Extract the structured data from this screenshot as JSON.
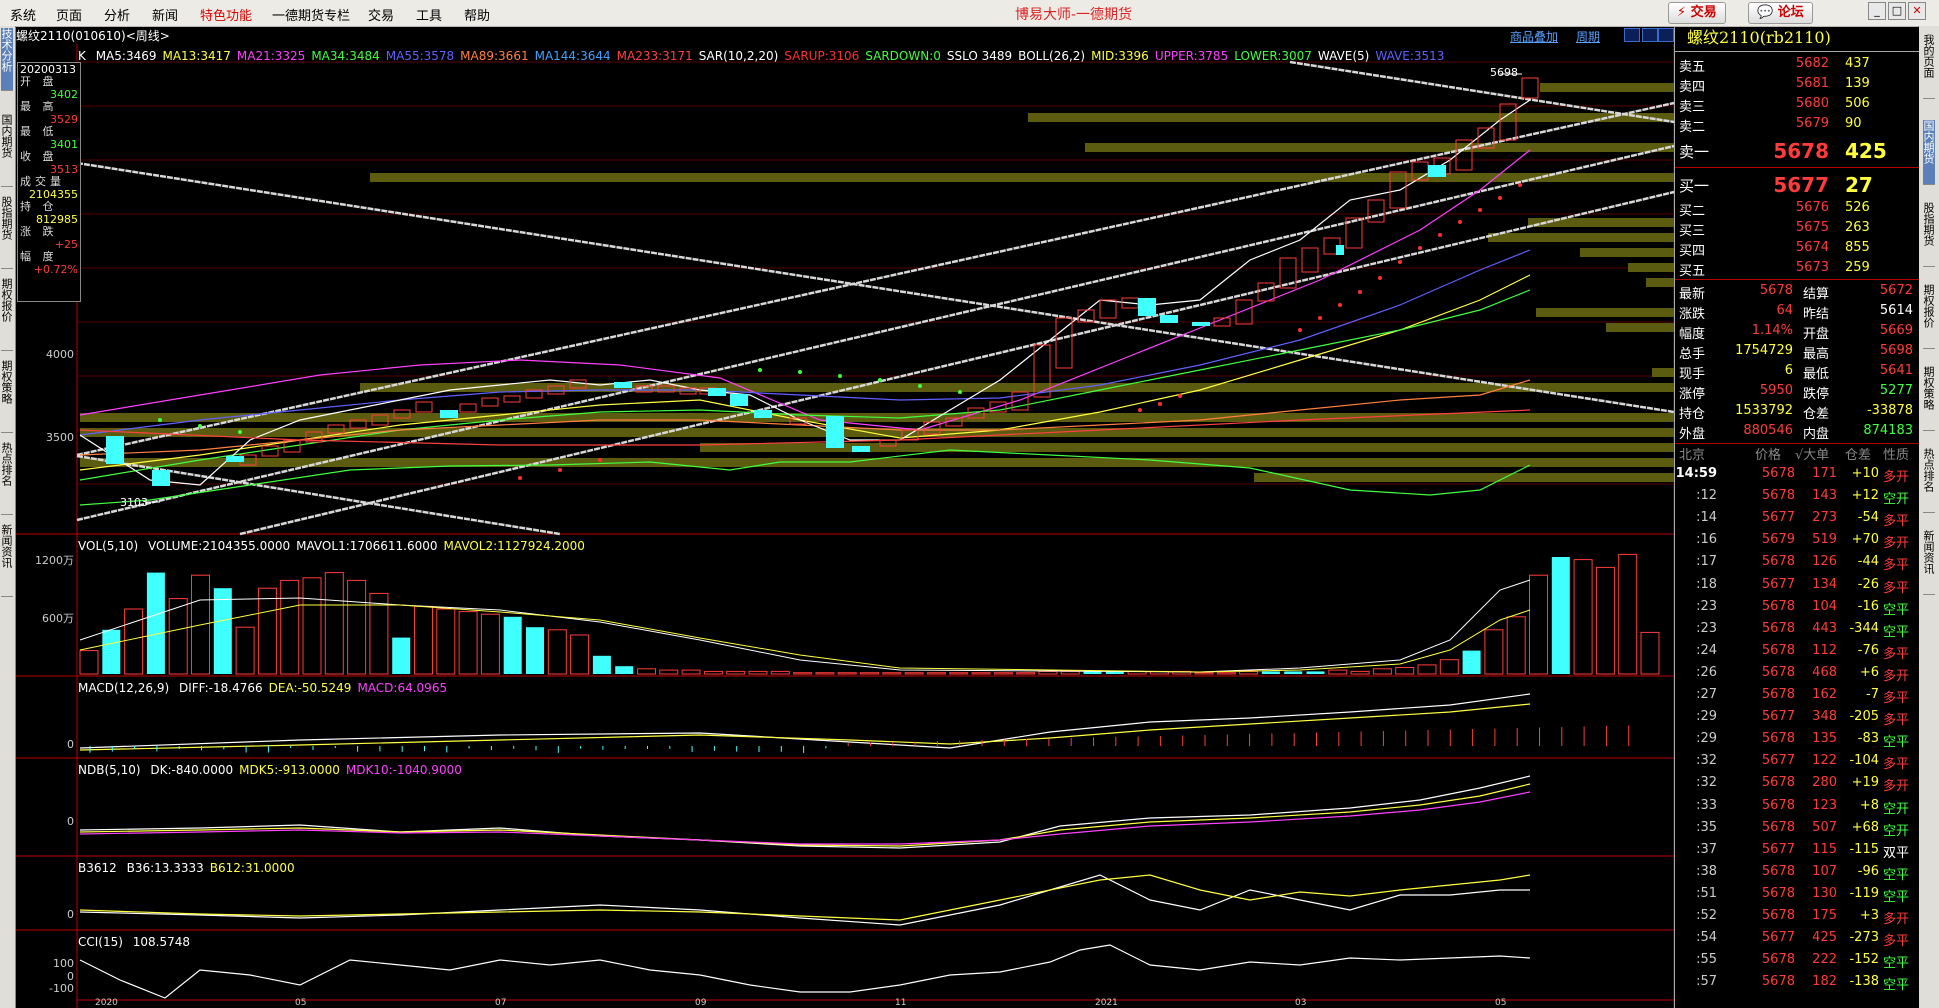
{
  "app": {
    "title": "博易大师-一德期货"
  },
  "menu": [
    "系统",
    "页面",
    "分析",
    "新闻",
    "特色功能",
    "一德期货专栏",
    "交易",
    "工具",
    "帮助"
  ],
  "top_buttons": {
    "trade": "交易",
    "forum": "论坛"
  },
  "left_tabs": [
    "技术分析",
    "国内期货",
    "股指期货",
    "期权报价",
    "期权策略",
    "热点排名",
    "新闻资讯"
  ],
  "right_tabs": [
    "我的页面",
    "国内期货",
    "股指期货",
    "期权报价",
    "期权策略",
    "热点排名",
    "新闻资讯"
  ],
  "chart": {
    "title": "螺纹2110(010610)<周线>",
    "toolbar": {
      "overlay": "商品叠加",
      "period": "周期"
    },
    "ma_prefix": "K",
    "ma_items": [
      {
        "text": "MA5:3469",
        "color": "#ffffff"
      },
      {
        "text": "MA13:3417",
        "color": "#ffff40"
      },
      {
        "text": "MA21:3325",
        "color": "#ff40ff"
      },
      {
        "text": "MA34:3484",
        "color": "#40ff40"
      },
      {
        "text": "MA55:3578",
        "color": "#6060ff"
      },
      {
        "text": "MA89:3661",
        "color": "#ff8040"
      },
      {
        "text": "MA144:3644",
        "color": "#40a0ff"
      },
      {
        "text": "MA233:3171",
        "color": "#ff4040"
      },
      {
        "text": "SAR(10,2,20)",
        "color": "#ffffff"
      },
      {
        "text": "SARUP:3106",
        "color": "#ff3030"
      },
      {
        "text": "SARDOWN:0",
        "color": "#40ff40"
      },
      {
        "text": "SSLO 3489",
        "color": "#ffffff"
      },
      {
        "text": "BOLL(26,2)",
        "color": "#ffffff"
      },
      {
        "text": "MID:3396",
        "color": "#ffff40"
      },
      {
        "text": "UPPER:3785",
        "color": "#ff40ff"
      },
      {
        "text": "LOWER:3007",
        "color": "#40ff40"
      },
      {
        "text": "WAVE(5)",
        "color": "#ffffff"
      },
      {
        "text": "WAVE:3513",
        "color": "#6060ff"
      }
    ],
    "price_axis": [
      "4000",
      "3500"
    ],
    "high_mark": "5698",
    "low_mark": "3103",
    "infobox": {
      "date": "20200313",
      "items": [
        {
          "k": "开 盘",
          "v": "3402",
          "c": "#40ff40"
        },
        {
          "k": "最 高",
          "v": "3529",
          "c": "#ff3b3b"
        },
        {
          "k": "最 低",
          "v": "3401",
          "c": "#40ff40"
        },
        {
          "k": "收 盘",
          "v": "3513",
          "c": "#ff3b3b"
        },
        {
          "k": "成交量",
          "v": "2104355",
          "c": "#ffff40"
        },
        {
          "k": "持 仓",
          "v": "812985",
          "c": "#ffff40"
        },
        {
          "k": "涨 跌",
          "v": "+25",
          "c": "#ff3b3b"
        },
        {
          "k": "幅 度",
          "v": "+0.72%",
          "c": "#ff3b3b"
        }
      ]
    },
    "vol": {
      "label": "VOL(5,10)",
      "items": [
        {
          "text": "VOLUME:2104355.0000",
          "color": "#ffffff"
        },
        {
          "text": "MAVOL1:1706611.6000",
          "color": "#ffffff"
        },
        {
          "text": "MAVOL2:1127924.2000",
          "color": "#ffff40"
        }
      ],
      "axis": [
        "1200万",
        "600万"
      ]
    },
    "macd": {
      "label": "MACD(12,26,9)",
      "items": [
        {
          "text": "DIFF:-18.4766",
          "color": "#ffffff"
        },
        {
          "text": "DEA:-50.5249",
          "color": "#ffff40"
        },
        {
          "text": "MACD:64.0965",
          "color": "#ff40ff"
        }
      ],
      "axis": [
        "0"
      ]
    },
    "ndb": {
      "label": "NDB(5,10)",
      "items": [
        {
          "text": "DK:-840.0000",
          "color": "#ffffff"
        },
        {
          "text": "MDK5:-913.0000",
          "color": "#ffff40"
        },
        {
          "text": "MDK10:-1040.9000",
          "color": "#ff40ff"
        }
      ],
      "axis": [
        "0"
      ]
    },
    "b3612": {
      "label": "B3612",
      "items": [
        {
          "text": "B36:13.3333",
          "color": "#ffffff"
        },
        {
          "text": "B612:31.0000",
          "color": "#ffff40"
        }
      ],
      "axis": [
        "0"
      ]
    },
    "cci": {
      "label": "CCI(15)",
      "items": [
        {
          "text": "108.5748",
          "color": "#ffffff"
        }
      ],
      "axis": [
        "100",
        "0",
        "-100"
      ]
    },
    "date_axis": [
      "2020",
      "05",
      "07",
      "09",
      "11",
      "2021",
      "03",
      "05"
    ]
  },
  "quote": {
    "title": "螺纹2110(rb2110)",
    "asks": [
      {
        "label": "卖五",
        "price": "5682",
        "vol": "437"
      },
      {
        "label": "卖四",
        "price": "5681",
        "vol": "139"
      },
      {
        "label": "卖三",
        "price": "5680",
        "vol": "506"
      },
      {
        "label": "卖二",
        "price": "5679",
        "vol": "90"
      },
      {
        "label": "卖一",
        "price": "5678",
        "vol": "425"
      }
    ],
    "bids": [
      {
        "label": "买一",
        "price": "5677",
        "vol": "27"
      },
      {
        "label": "买二",
        "price": "5676",
        "vol": "526"
      },
      {
        "label": "买三",
        "price": "5675",
        "vol": "263"
      },
      {
        "label": "买四",
        "price": "5674",
        "vol": "855"
      },
      {
        "label": "买五",
        "price": "5673",
        "vol": "259"
      }
    ],
    "stats": [
      {
        "k1": "最新",
        "v1": "5678",
        "c1": "#ff3b3b",
        "k2": "结算",
        "v2": "5672",
        "c2": "#ff3b3b"
      },
      {
        "k1": "涨跌",
        "v1": "64",
        "c1": "#ff3b3b",
        "k2": "昨结",
        "v2": "5614",
        "c2": "#ffffff"
      },
      {
        "k1": "幅度",
        "v1": "1.14%",
        "c1": "#ff3b3b",
        "k2": "开盘",
        "v2": "5669",
        "c2": "#ff3b3b"
      },
      {
        "k1": "总手",
        "v1": "1754729",
        "c1": "#ffff40",
        "k2": "最高",
        "v2": "5698",
        "c2": "#ff3b3b"
      },
      {
        "k1": "现手",
        "v1": "6",
        "c1": "#ffff40",
        "k2": "最低",
        "v2": "5641",
        "c2": "#ff3b3b"
      },
      {
        "k1": "涨停",
        "v1": "5950",
        "c1": "#ff3b3b",
        "k2": "跌停",
        "v2": "5277",
        "c2": "#40ff40"
      },
      {
        "k1": "持仓",
        "v1": "1533792",
        "c1": "#ffff40",
        "k2": "仓差",
        "v2": "-33878",
        "c2": "#ffff40"
      },
      {
        "k1": "外盘",
        "v1": "880546",
        "c1": "#ff3b3b",
        "k2": "内盘",
        "v2": "874183",
        "c2": "#40ff40"
      }
    ],
    "tick_header": {
      "loc": "北京",
      "price": "价格",
      "vol": "√大单",
      "diff": "仓差",
      "nature": "性质"
    },
    "ticks": [
      {
        "t": "14:59",
        "p": "5678",
        "v": "171",
        "d": "+10",
        "n": "多开",
        "nc": "#ff3b3b"
      },
      {
        "t": ":12",
        "p": "5678",
        "v": "143",
        "d": "+12",
        "n": "空开",
        "nc": "#40ff40"
      },
      {
        "t": ":14",
        "p": "5677",
        "v": "273",
        "d": "-54",
        "n": "多平",
        "nc": "#ff3b3b"
      },
      {
        "t": ":16",
        "p": "5679",
        "v": "519",
        "d": "+70",
        "n": "多开",
        "nc": "#ff3b3b"
      },
      {
        "t": ":17",
        "p": "5678",
        "v": "126",
        "d": "-44",
        "n": "多平",
        "nc": "#ff3b3b"
      },
      {
        "t": ":18",
        "p": "5677",
        "v": "134",
        "d": "-26",
        "n": "多平",
        "nc": "#ff3b3b"
      },
      {
        "t": ":23",
        "p": "5678",
        "v": "104",
        "d": "-16",
        "n": "空平",
        "nc": "#40ff40"
      },
      {
        "t": ":23",
        "p": "5678",
        "v": "443",
        "d": "-344",
        "n": "空平",
        "nc": "#40ff40"
      },
      {
        "t": ":24",
        "p": "5678",
        "v": "112",
        "d": "-76",
        "n": "多平",
        "nc": "#ff3b3b"
      },
      {
        "t": ":26",
        "p": "5678",
        "v": "468",
        "d": "+6",
        "n": "多开",
        "nc": "#ff3b3b"
      },
      {
        "t": ":27",
        "p": "5678",
        "v": "162",
        "d": "-7",
        "n": "多平",
        "nc": "#ff3b3b"
      },
      {
        "t": ":29",
        "p": "5677",
        "v": "348",
        "d": "-205",
        "n": "多平",
        "nc": "#ff3b3b"
      },
      {
        "t": ":29",
        "p": "5678",
        "v": "135",
        "d": "-83",
        "n": "空平",
        "nc": "#40ff40"
      },
      {
        "t": ":32",
        "p": "5677",
        "v": "122",
        "d": "-104",
        "n": "多平",
        "nc": "#ff3b3b"
      },
      {
        "t": ":32",
        "p": "5678",
        "v": "280",
        "d": "+19",
        "n": "多开",
        "nc": "#ff3b3b"
      },
      {
        "t": ":33",
        "p": "5678",
        "v": "123",
        "d": "+8",
        "n": "空开",
        "nc": "#40ff40"
      },
      {
        "t": ":35",
        "p": "5678",
        "v": "507",
        "d": "+68",
        "n": "空开",
        "nc": "#40ff40"
      },
      {
        "t": ":37",
        "p": "5677",
        "v": "115",
        "d": "-115",
        "n": "双平",
        "nc": "#ffffff"
      },
      {
        "t": ":38",
        "p": "5678",
        "v": "107",
        "d": "-96",
        "n": "空平",
        "nc": "#40ff40"
      },
      {
        "t": ":51",
        "p": "5678",
        "v": "130",
        "d": "-119",
        "n": "空平",
        "nc": "#40ff40"
      },
      {
        "t": ":52",
        "p": "5678",
        "v": "175",
        "d": "+3",
        "n": "多开",
        "nc": "#ff3b3b"
      },
      {
        "t": ":54",
        "p": "5677",
        "v": "425",
        "d": "-273",
        "n": "多平",
        "nc": "#ff3b3b"
      },
      {
        "t": ":55",
        "p": "5678",
        "v": "222",
        "d": "-152",
        "n": "空平",
        "nc": "#40ff40"
      },
      {
        "t": ":57",
        "p": "5678",
        "v": "182",
        "d": "-138",
        "n": "空平",
        "nc": "#40ff40"
      }
    ]
  }
}
